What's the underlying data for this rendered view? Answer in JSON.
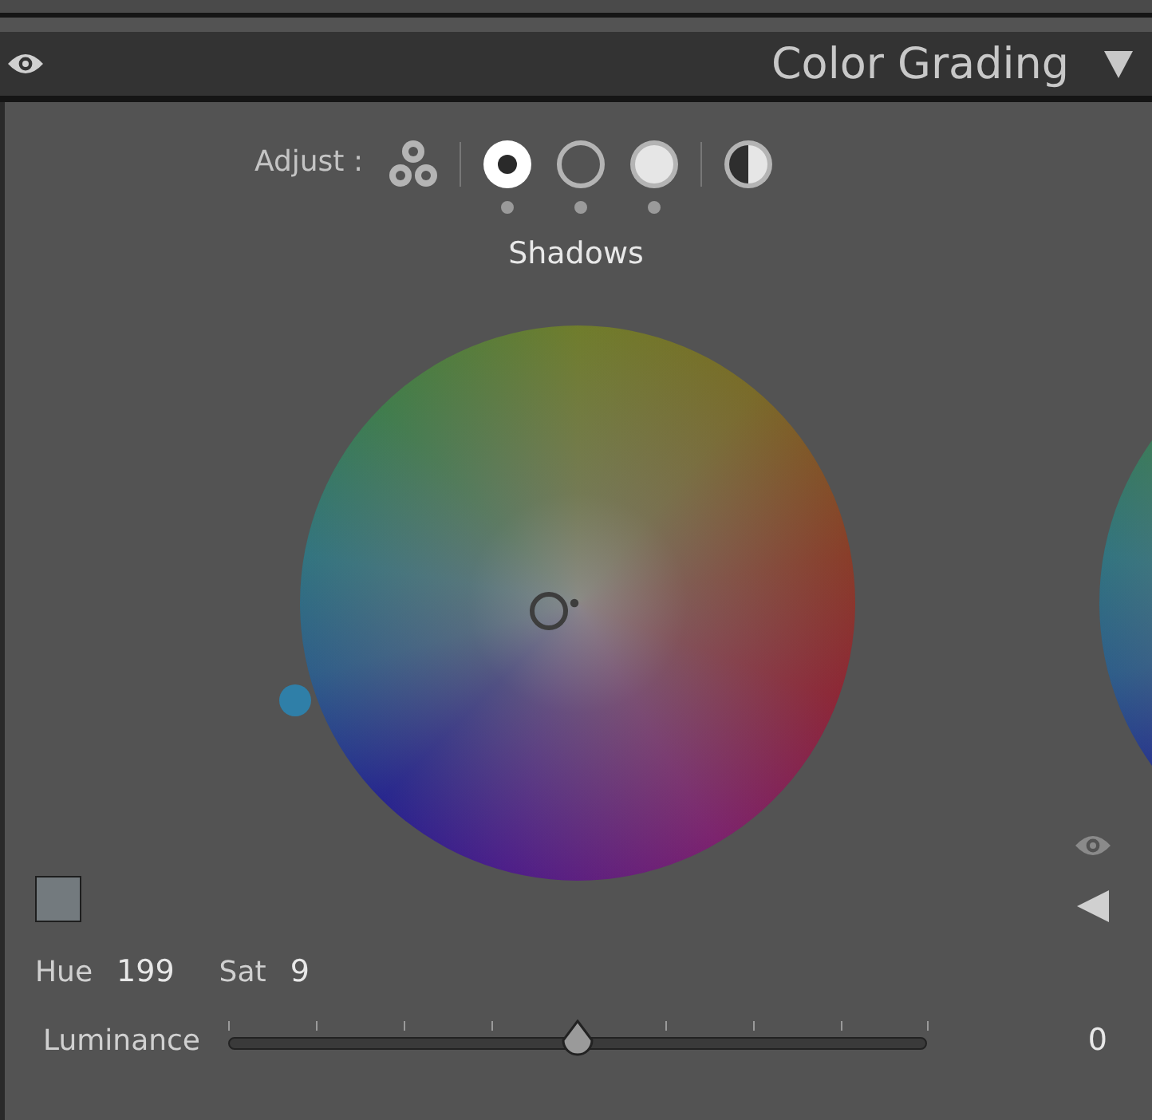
{
  "panel": {
    "title": "Color Grading",
    "expanded": true
  },
  "adjust": {
    "label": "Adjust :",
    "modes": [
      {
        "kind": "three-way",
        "selected": false
      },
      {
        "kind": "shadows",
        "selected": true
      },
      {
        "kind": "midtones",
        "selected": false
      },
      {
        "kind": "highlights",
        "selected": false
      },
      {
        "kind": "global",
        "selected": false
      }
    ]
  },
  "wheel": {
    "label": "Shadows"
  },
  "hue": {
    "label": "Hue",
    "value": "199"
  },
  "sat": {
    "label": "Sat",
    "value": "9"
  },
  "luminance": {
    "label": "Luminance",
    "level": 0.5,
    "value": "0"
  }
}
